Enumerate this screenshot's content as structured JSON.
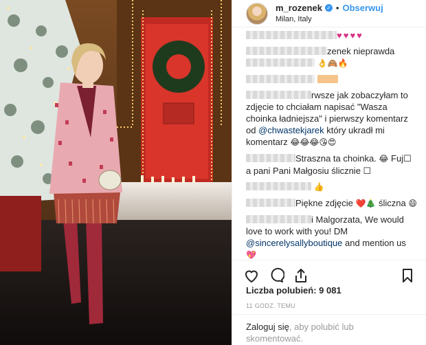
{
  "header": {
    "username": "m_rozenek",
    "verified_icon": "verified-badge-icon",
    "separator": "•",
    "follow_label": "Obserwuj",
    "location": "Milan, Italy"
  },
  "comments": [
    {
      "tail": "♥♥♥♥",
      "accent": "#d63384"
    },
    {
      "text": "zenek nieprawda",
      "emoji": "👌🙈🔥"
    },
    {
      "text": ""
    },
    {
      "text_a": "rwsze jak zobaczyłam to zdjęcie to chciałam napisać \"Wasza choinka ładniejsza\" i pierwszy komentarz od ",
      "mention": "@chwastekjarek",
      "text_b": " który ukradł mi komentarz",
      "emoji": "😂😂😂😘😍"
    },
    {
      "text_a": "Straszna ta choinka. ",
      "emoji": "😂",
      "text_b": " Fuj☐ a pani Pani Małgosiu ślicznie ☐"
    },
    {
      "emoji": "👍"
    },
    {
      "text": "Piękne zdjęcie ",
      "emoji": "❤️🎄",
      "text_b": " śliczna ",
      "emoji_b": "😄"
    },
    {
      "text_a": "i Malgorzata, We would love to work with you! DM ",
      "mention": "@sincerelysallyboutique",
      "text_b": " and mention us ",
      "emoji": "💖"
    },
    {
      "tail": "♥♥♥♥♥"
    }
  ],
  "actions": {
    "like_icon": "heart-icon",
    "comment_icon": "comment-icon",
    "share_icon": "share-icon",
    "save_icon": "bookmark-icon"
  },
  "likes_text": "Liczba polubień: 9 081",
  "timestamp": "11 GODZ. TEMU",
  "login": {
    "link": "Zaloguj się",
    "rest": ", aby polubić lub skomentować."
  }
}
